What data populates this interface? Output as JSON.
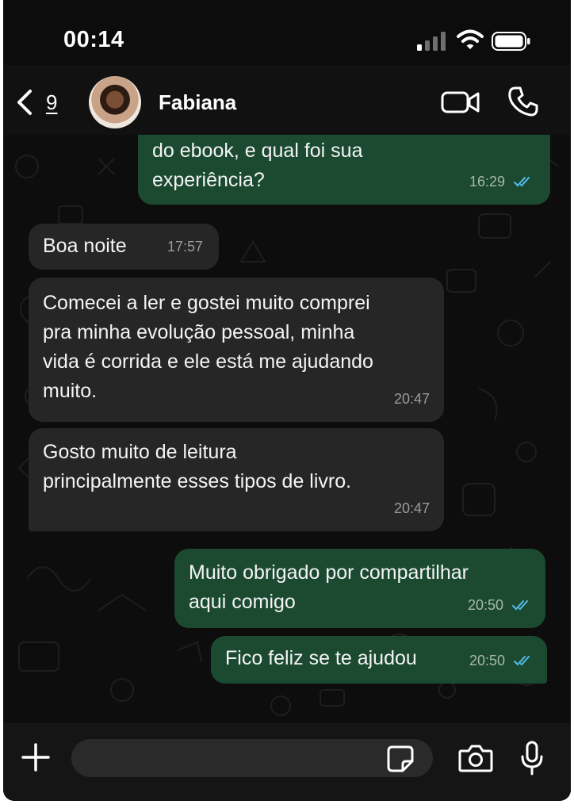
{
  "status_bar": {
    "time": "00:14"
  },
  "header": {
    "back_count": "9",
    "contact_name": "Fabiana"
  },
  "messages": [
    {
      "direction": "out",
      "text_lines": [
        "do ebook, e qual foi sua",
        "experiência?"
      ],
      "time": "16:29",
      "read": true
    },
    {
      "direction": "in",
      "text": "Boa noite",
      "time": "17:57"
    },
    {
      "direction": "in",
      "text_lines": [
        "Comecei a ler e gostei muito comprei",
        "pra minha evolução pessoal, minha",
        "vida é corrida e ele está me ajudando",
        "muito."
      ],
      "time": "20:47"
    },
    {
      "direction": "in",
      "text_lines": [
        "Gosto muito de leitura",
        "principalmente esses tipos de  livro."
      ],
      "time": "20:47"
    },
    {
      "direction": "out",
      "text_lines": [
        "Muito obrigado por compartilhar",
        "aqui comigo"
      ],
      "time": "20:50",
      "read": true
    },
    {
      "direction": "out",
      "text": "Fico feliz se te ajudou",
      "time": "20:50",
      "read": true
    }
  ],
  "input_bar": {
    "placeholder": ""
  },
  "colors": {
    "outgoing_bubble": "#1b4a31",
    "incoming_bubble": "#262626",
    "read_ticks": "#53bdeb",
    "background": "#0c0c0c"
  },
  "icons": [
    "back-chevron",
    "video-call",
    "phone-call",
    "plus",
    "sticker",
    "camera",
    "microphone",
    "signal-bars",
    "wifi",
    "battery",
    "double-check"
  ]
}
